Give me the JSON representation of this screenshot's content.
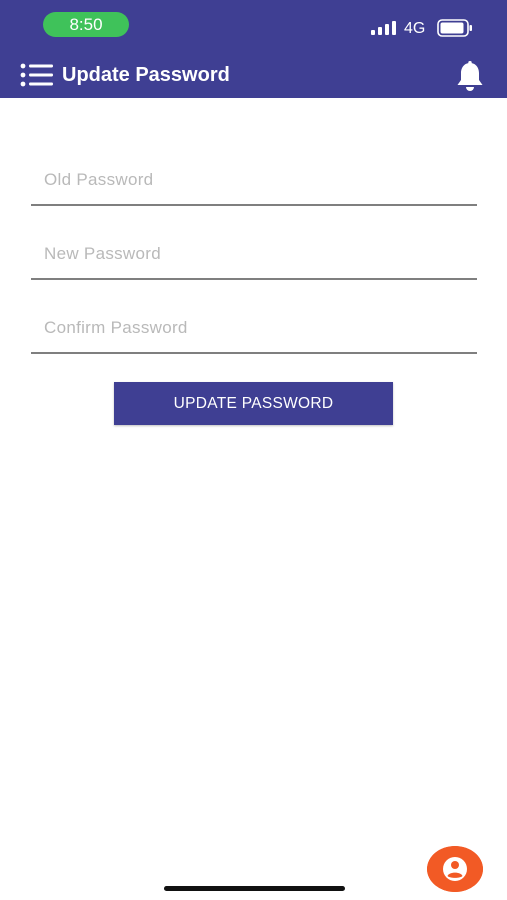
{
  "status_bar": {
    "time": "8:50",
    "network": "4G",
    "signal_icon": "cellular-signal-icon",
    "battery_icon": "battery-icon"
  },
  "header": {
    "title": "Update Password",
    "menu_icon": "menu-list-icon",
    "bell_icon": "bell-icon"
  },
  "form": {
    "old_password": {
      "placeholder": "Old Password",
      "value": ""
    },
    "new_password": {
      "placeholder": "New Password",
      "value": ""
    },
    "confirm_password": {
      "placeholder": "Confirm Password",
      "value": ""
    },
    "submit_label": "UPDATE PASSWORD"
  },
  "fab": {
    "icon": "user-account-icon"
  },
  "colors": {
    "header": "#3f3f93",
    "button": "#3f3f93",
    "time_pill": "#3fc25a",
    "fab": "#f25a25",
    "placeholder": "#b9b9b9",
    "field_underline": "#7f7f7f"
  }
}
